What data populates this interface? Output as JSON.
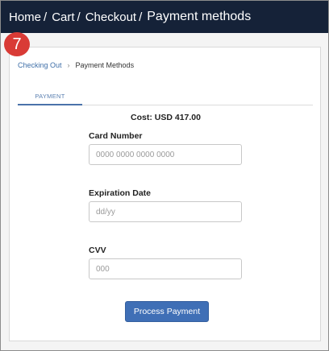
{
  "topbar": {
    "breadcrumbs": [
      "Home",
      "Cart",
      "Checkout"
    ],
    "current": "Payment methods",
    "separator": "/"
  },
  "step_badge": "7",
  "card": {
    "breadcrumb": {
      "link": "Checking Out",
      "separator": "›",
      "current": "Payment Methods"
    },
    "tabs": [
      {
        "label": "PAYMENT",
        "active": true
      }
    ],
    "cost_label": "Cost: USD 417.00",
    "fields": {
      "card_number": {
        "label": "Card Number",
        "placeholder": "0000 0000 0000 0000",
        "value": ""
      },
      "expiration": {
        "label": "Expiration Date",
        "placeholder": "dd/yy",
        "value": ""
      },
      "cvv": {
        "label": "CVV",
        "placeholder": "000",
        "value": ""
      }
    },
    "submit_label": "Process Payment"
  },
  "colors": {
    "topbar_bg": "#152238",
    "badge": "#d93b36",
    "accent": "#3f6fb6",
    "link": "#3f6fa8"
  }
}
